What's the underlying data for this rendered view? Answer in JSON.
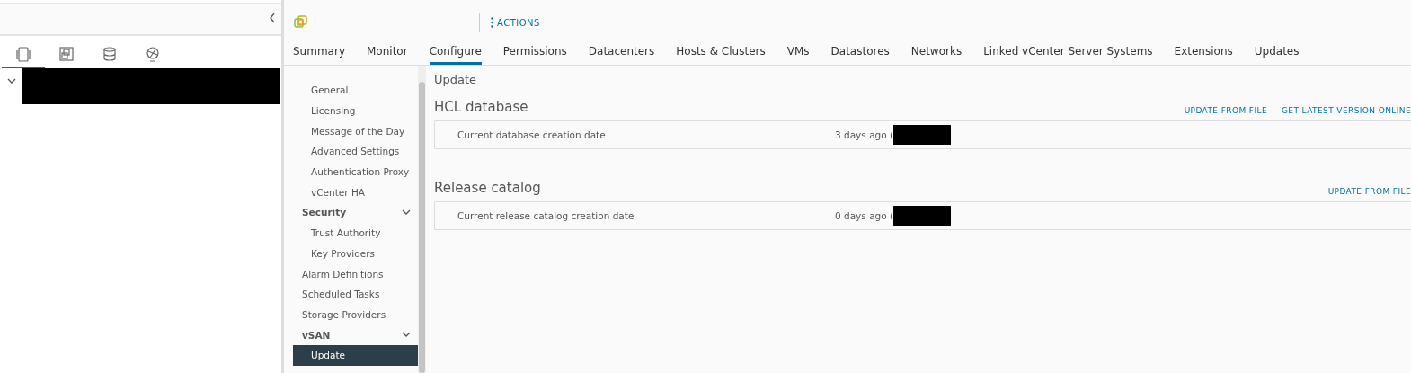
{
  "inventory_tabs": [
    {
      "kind": "hosts",
      "selected": true
    },
    {
      "kind": "vms",
      "selected": false
    },
    {
      "kind": "storage",
      "selected": false
    },
    {
      "kind": "network",
      "selected": false
    }
  ],
  "tree": {
    "expanded": true
  },
  "header": {
    "actions_label": "ACTIONS"
  },
  "tabs": [
    {
      "label": "Summary",
      "selected": false
    },
    {
      "label": "Monitor",
      "selected": false
    },
    {
      "label": "Configure",
      "selected": true
    },
    {
      "label": "Permissions",
      "selected": false
    },
    {
      "label": "Datacenters",
      "selected": false
    },
    {
      "label": "Hosts & Clusters",
      "selected": false
    },
    {
      "label": "VMs",
      "selected": false
    },
    {
      "label": "Datastores",
      "selected": false
    },
    {
      "label": "Networks",
      "selected": false
    },
    {
      "label": "Linked vCenter Server Systems",
      "selected": false
    },
    {
      "label": "Extensions",
      "selected": false
    },
    {
      "label": "Updates",
      "selected": false
    }
  ],
  "sidebar": {
    "items": [
      {
        "kind": "item",
        "label": "General",
        "selected": false
      },
      {
        "kind": "item",
        "label": "Licensing",
        "selected": false
      },
      {
        "kind": "item",
        "label": "Message of the Day",
        "selected": false
      },
      {
        "kind": "item",
        "label": "Advanced Settings",
        "selected": false
      },
      {
        "kind": "item",
        "label": "Authentication Proxy",
        "selected": false
      },
      {
        "kind": "item",
        "label": "vCenter HA",
        "selected": false
      },
      {
        "kind": "group",
        "label": "Security",
        "expanded": true,
        "children": [
          {
            "label": "Trust Authority",
            "selected": false
          },
          {
            "label": "Key Providers",
            "selected": false
          }
        ]
      },
      {
        "kind": "top",
        "label": "Alarm Definitions",
        "selected": false
      },
      {
        "kind": "top",
        "label": "Scheduled Tasks",
        "selected": false
      },
      {
        "kind": "top",
        "label": "Storage Providers",
        "selected": false
      },
      {
        "kind": "group",
        "label": "vSAN",
        "expanded": true,
        "children": [
          {
            "label": "Update",
            "selected": true
          }
        ]
      }
    ]
  },
  "page_title": "Update",
  "sections": [
    {
      "title": "HCL database",
      "actions": [
        "UPDATE FROM FILE",
        "GET LATEST VERSION ONLINE"
      ],
      "row": {
        "label": "Current database creation date",
        "value": "3 days ago ("
      }
    },
    {
      "title": "Release catalog",
      "actions": [
        "UPDATE FROM FILE"
      ],
      "row": {
        "label": "Current release catalog creation date",
        "value": "0 days ago ("
      }
    }
  ]
}
